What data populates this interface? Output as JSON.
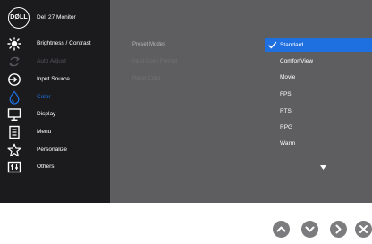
{
  "brand": {
    "logo_text": "DØLL",
    "monitor_name": "Dell 27 Monitor"
  },
  "menu": {
    "items": [
      {
        "label": "Brightness / Contrast",
        "icon": "brightness-icon",
        "state": "normal"
      },
      {
        "label": "Auto Adjust",
        "icon": "auto-adjust-icon",
        "state": "disabled"
      },
      {
        "label": "Input Source",
        "icon": "input-source-icon",
        "state": "normal"
      },
      {
        "label": "Color",
        "icon": "color-drop-icon",
        "state": "selected"
      },
      {
        "label": "Display",
        "icon": "display-icon",
        "state": "normal"
      },
      {
        "label": "Menu",
        "icon": "menu-list-icon",
        "state": "normal"
      },
      {
        "label": "Personalize",
        "icon": "star-icon",
        "state": "normal"
      },
      {
        "label": "Others",
        "icon": "others-icon",
        "state": "normal"
      }
    ]
  },
  "submenu": {
    "items": [
      {
        "label": "Preset Modes",
        "state": "active"
      },
      {
        "label": "Input Color Format",
        "state": "dim"
      },
      {
        "label": "Reset Color",
        "state": "dim"
      }
    ]
  },
  "options": {
    "selected": "Standard",
    "items": [
      "Standard",
      "ComfortView",
      "Movie",
      "FPS",
      "RTS",
      "RPG",
      "Warm"
    ],
    "more_indicator": "chevron-down-icon"
  },
  "buttons": [
    "up-button",
    "down-button",
    "right-button",
    "close-button"
  ],
  "colors": {
    "accent": "#1e6fe0",
    "sidebar": "#1b1b1d",
    "panel": "#5e5e60",
    "button": "#7c7c7f"
  }
}
